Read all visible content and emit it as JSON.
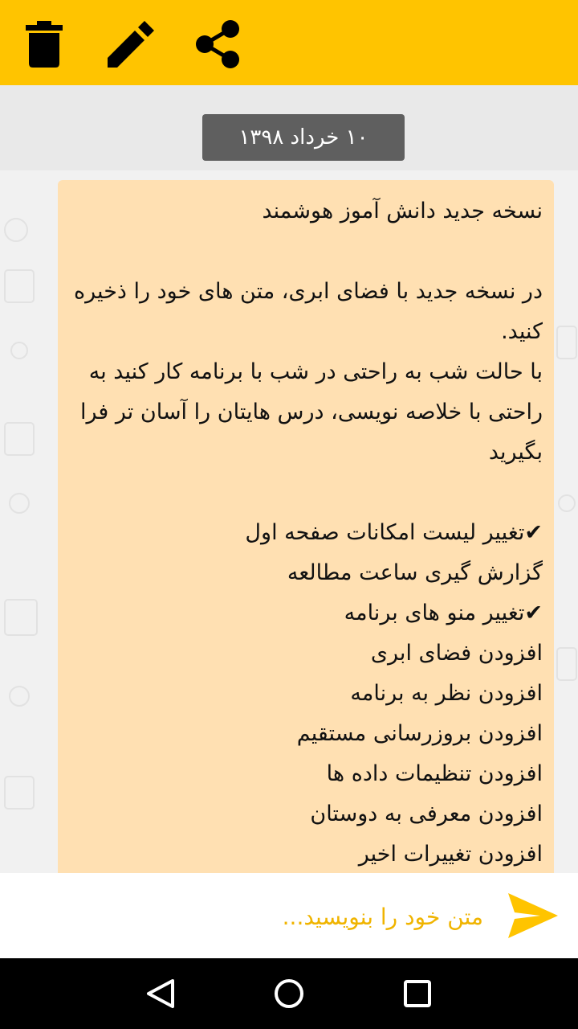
{
  "toolbar": {
    "icons": [
      "trash-icon",
      "edit-pencil-icon",
      "share-icon"
    ],
    "accent": "#ffc400"
  },
  "chat": {
    "date_chip": "۱۰ خرداد ۱۳۹۸",
    "message_lines": [
      "نسخه جدید دانش آموز هوشمند",
      "",
      "در نسخه جدید با فضای ابری، متن های خود را ذخیره کنید.",
      "با حالت شب به راحتی در شب با برنامه کار کنید به راحتی با خلاصه نویسی، درس هایتان را آسان تر فرا بگیرید",
      "",
      "✔تغییر لیست امکانات صفحه اول",
      "گزارش گیری ساعت مطالعه",
      "✔تغییر منو های برنامه",
      "افزودن فضای ابری",
      "افزودن نظر به برنامه",
      "افزودن بروزرسانی مستقیم",
      "افزودن تنظیمات داده ها",
      "افزودن معرفی به دوستان",
      "افزودن تغییرات اخیر"
    ],
    "bubble_color": "#ffe0b2"
  },
  "composer": {
    "placeholder": "متن خود را بنویسید...",
    "value": "",
    "send_icon": "send-icon"
  },
  "navbar": {
    "icons": [
      "back-icon",
      "home-icon",
      "recents-icon"
    ]
  }
}
